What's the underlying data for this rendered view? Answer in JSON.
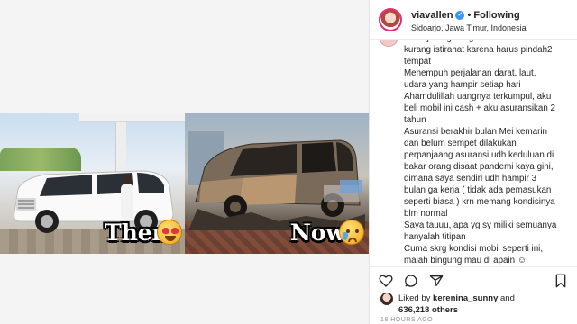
{
  "post": {
    "username": "viavallen",
    "follow_status": "Following",
    "location": "Sidoarjo, Jawa Timur, Indonesia",
    "caption": "di sla jarang banget dirumah dan\nkurang istirahat karena harus pindah2\ntempat\nMenempuh perjalanan darat, laut,\nudara yang hampir setiap hari\nAhamdulillah uangnya terkumpul, aku\nbeli mobil ini cash + aku asuransikan 2\ntahun\nAsuransi berakhir bulan Mei kemarin\ndan belum sempet dilakukan\nperpanjaang asuransi udh keduluan di\nbakar orang disaat pandemi kaya gini,\ndimana saya sendiri udh hampir 3\nbulan ga kerja ( tidak ada pemasukan\nseperti biasa ) krn memang kondisinya\nblm normal\nSaya tauuu, apa yg sy miliki semuanya\nhanyalah titipan\nCuma skrg kondisi mobil seperti ini,\nmalah bingung mau di apain ☺",
    "liked_prefix": "Liked by ",
    "liked_by": "kerenina_sunny",
    "liked_and": " and",
    "likes_count": "636,218 others",
    "timestamp": "18 HOURS AGO"
  },
  "image": {
    "then_label": "Then",
    "now_label": "Now",
    "then_emoji": "heart-eyes-emoji",
    "now_emoji": "crying-emoji"
  },
  "colors": {
    "verified": "#3897f0",
    "text": "#262626",
    "muted": "#8e8e8e"
  },
  "icons": [
    "heart-icon",
    "comment-icon",
    "share-icon",
    "bookmark-icon"
  ]
}
